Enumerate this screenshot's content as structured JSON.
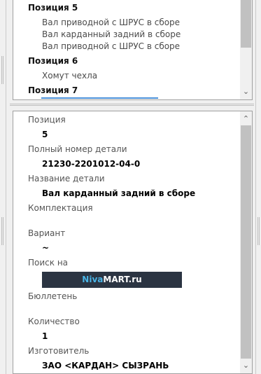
{
  "parts_list": {
    "groups": [
      {
        "title": "Позиция 5",
        "items": [
          "Вал приводной с ШРУС в сборе",
          "Вал карданный задний в сборе",
          "Вал приводной с ШРУС в сборе"
        ]
      },
      {
        "title": "Позиция 6",
        "items": [
          "Хомут чехла"
        ]
      },
      {
        "title": "Позиция 7",
        "items": []
      }
    ]
  },
  "details": {
    "position_label": "Позиция",
    "position_value": "5",
    "part_number_label": "Полный номер детали",
    "part_number_value": "21230-2201012-04-0",
    "part_name_label": "Название детали",
    "part_name_value": "Вал карданный задний в сборе",
    "kit_label": "Комплектация",
    "variant_label": "Вариант",
    "variant_value": "~",
    "search_label": "Поиск на",
    "search_logo_a": "Niva",
    "search_logo_b": "MART.ru",
    "bulletin_label": "Бюллетень",
    "quantity_label": "Количество",
    "quantity_value": "1",
    "manufacturer_label": "Изготовитель",
    "manufacturer_value": "ЗАО <КАРДАН> СЫЗРАНЬ"
  },
  "icons": {
    "scroll_up": "chevron-up-icon",
    "scroll_down": "chevron-down-icon"
  }
}
